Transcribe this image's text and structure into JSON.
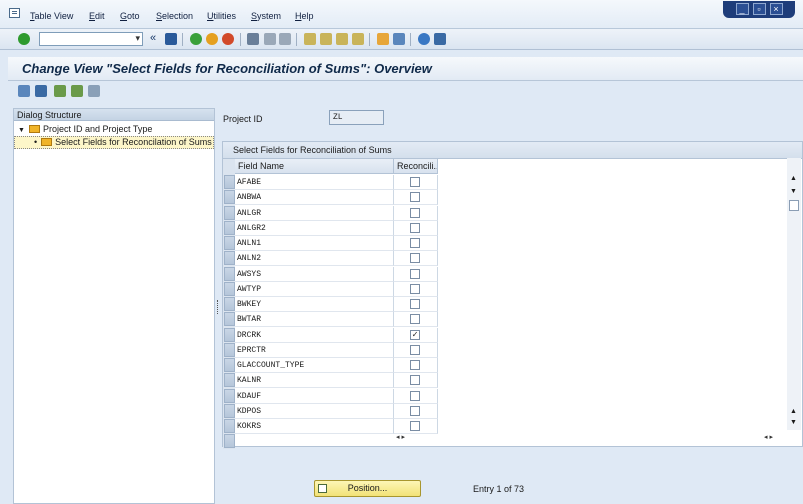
{
  "menu": {
    "items": [
      "Table View",
      "Edit",
      "Goto",
      "Selection",
      "Utilities",
      "System",
      "Help"
    ]
  },
  "title": "Change View \"Select Fields for Reconciliation of Sums\": Overview",
  "dialog_structure": {
    "header": "Dialog Structure",
    "nodes": [
      {
        "label": "Project ID and Project Type"
      },
      {
        "label": "Select Fields for Reconcilation of Sums"
      }
    ]
  },
  "project": {
    "label": "Project ID",
    "value": "ZL"
  },
  "table": {
    "caption": "Select Fields for Reconciliation of Sums",
    "columns": [
      "Field Name",
      "Reconcili..."
    ],
    "rows": [
      {
        "field": "AFABE",
        "checked": false
      },
      {
        "field": "ANBWA",
        "checked": false
      },
      {
        "field": "ANLGR",
        "checked": false
      },
      {
        "field": "ANLGR2",
        "checked": false
      },
      {
        "field": "ANLN1",
        "checked": false
      },
      {
        "field": "ANLN2",
        "checked": false
      },
      {
        "field": "AWSYS",
        "checked": false
      },
      {
        "field": "AWTYP",
        "checked": false
      },
      {
        "field": "BWKEY",
        "checked": false
      },
      {
        "field": "BWTAR",
        "checked": false
      },
      {
        "field": "DRCRK",
        "checked": true
      },
      {
        "field": "EPRCTR",
        "checked": false
      },
      {
        "field": "GLACCOUNT_TYPE",
        "checked": false
      },
      {
        "field": "KALNR",
        "checked": false
      },
      {
        "field": "KDAUF",
        "checked": false
      },
      {
        "field": "KDPOS",
        "checked": false
      },
      {
        "field": "KOKRS",
        "checked": false
      }
    ]
  },
  "footer": {
    "position_label": "Position...",
    "entry_text": "Entry 1 of 73"
  },
  "colors": {
    "accent": "#1e3d7a",
    "position_button": "#f2e277",
    "folder": "#f0b429"
  }
}
